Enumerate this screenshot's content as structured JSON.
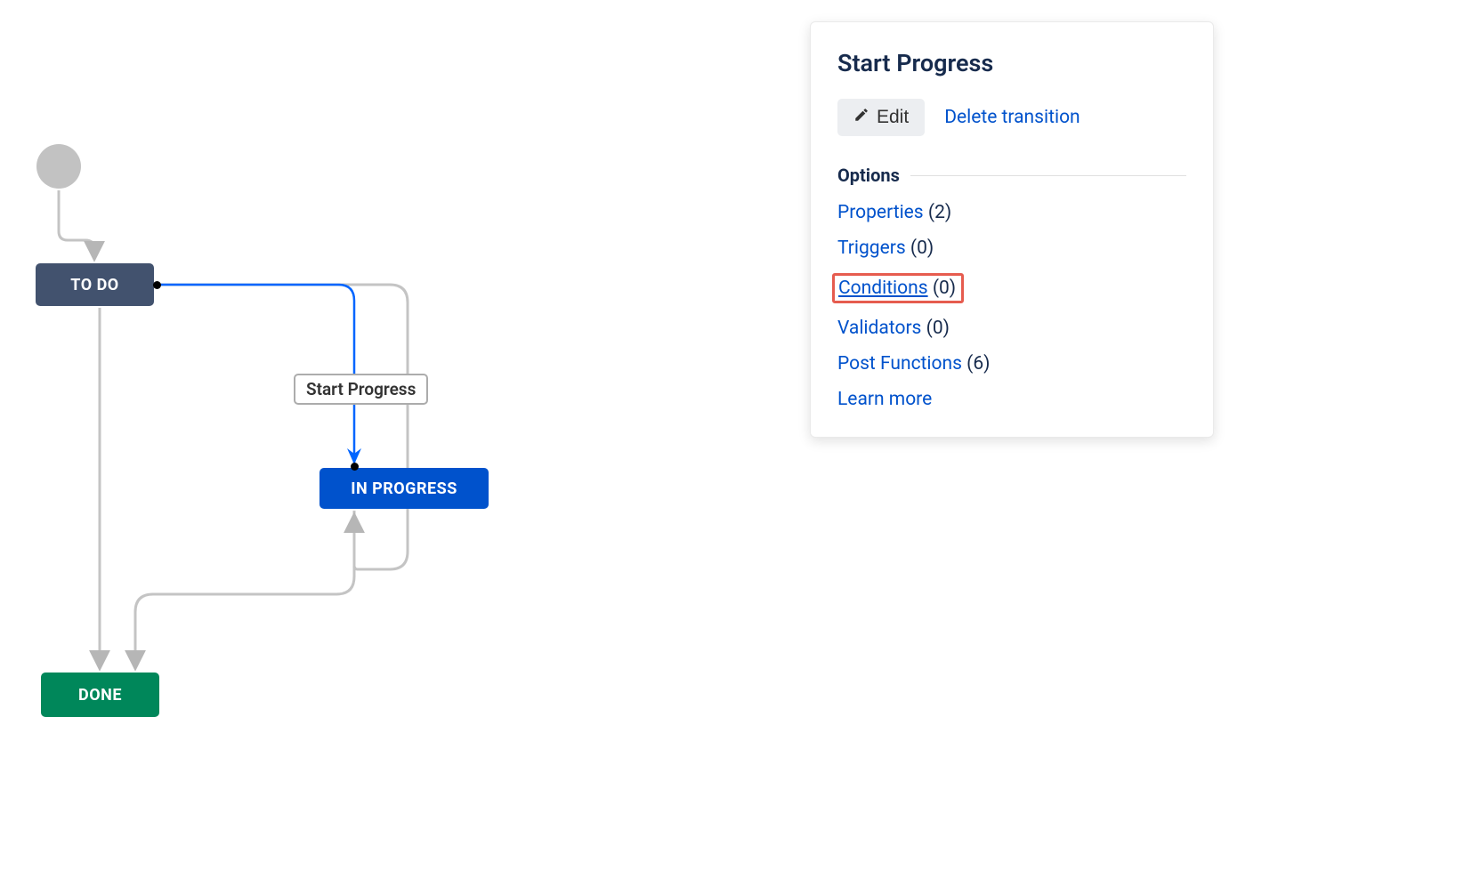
{
  "flow": {
    "status_todo": "TO DO",
    "status_in_progress": "IN PROGRESS",
    "status_done": "DONE",
    "transition_label": "Start Progress"
  },
  "panel": {
    "title": "Start Progress",
    "edit_label": "Edit",
    "delete_label": "Delete transition",
    "options_heading": "Options",
    "learn_more": "Learn more",
    "items": {
      "properties": {
        "label": "Properties",
        "count": "(2)"
      },
      "triggers": {
        "label": "Triggers",
        "count": "(0)"
      },
      "conditions": {
        "label": "Conditions",
        "count": "(0)"
      },
      "validators": {
        "label": "Validators",
        "count": "(0)"
      },
      "post_functions": {
        "label": "Post Functions",
        "count": "(6)"
      }
    }
  }
}
